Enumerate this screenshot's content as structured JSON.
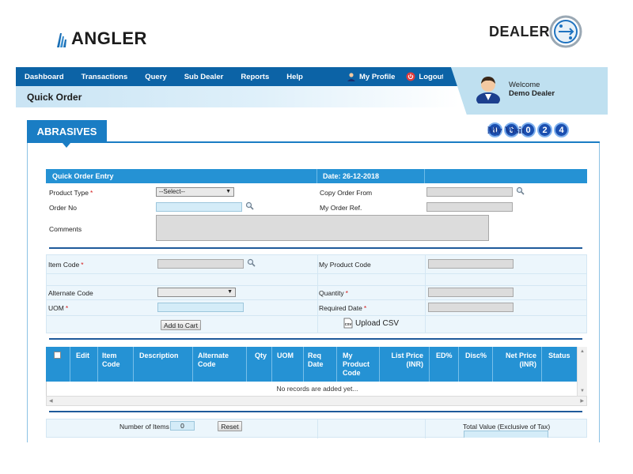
{
  "brand": {
    "left_logo": "ANGLER",
    "right_logo": "DEALER"
  },
  "nav": {
    "items": [
      "Dashboard",
      "Transactions",
      "Query",
      "Sub Dealer",
      "Reports",
      "Help"
    ],
    "my_profile": "My Profile",
    "logout": "Logout"
  },
  "page_title": "Quick Order",
  "user": {
    "welcome": "Welcome",
    "name": "Demo Dealer"
  },
  "section_tab": "ABRASIVES",
  "my_visit": {
    "label": "My Visit",
    "digits": [
      "0",
      "0",
      "0",
      "2",
      "4"
    ]
  },
  "quick_order": {
    "header": "Quick Order Entry",
    "date": "Date: 26-12-2018",
    "product_type_label": "Product Type",
    "product_type_value": "--Select--",
    "order_no_label": "Order No",
    "comments_label": "Comments",
    "copy_order_from_label": "Copy Order From",
    "my_order_ref_label": "My Order Ref."
  },
  "item": {
    "item_code_label": "Item Code",
    "alternate_code_label": "Alternate Code",
    "uom_label": "UOM",
    "my_product_code_label": "My Product Code",
    "quantity_label": "Quantity",
    "required_date_label": "Required Date",
    "add_to_cart": "Add to Cart",
    "upload_csv": "Upload CSV",
    "csv_icon_text": "CSV"
  },
  "grid": {
    "columns": [
      "Edit",
      "Item Code",
      "Description",
      "Alternate Code",
      "Qty",
      "UOM",
      "Req Date",
      "My Product Code",
      "List Price (INR)",
      "ED%",
      "Disc%",
      "Net Price (INR)",
      "Status"
    ],
    "empty_text": "No records are added yet..."
  },
  "footer": {
    "number_of_items_label": "Number of Items",
    "number_of_items_value": "0",
    "reset": "Reset",
    "total_value_label": "Total Value (Exclusive of Tax)"
  },
  "colors": {
    "nav": "#0c63a6",
    "accent": "#1a7dc4",
    "grid_header": "#2592d4",
    "required": "#d41b1b"
  }
}
